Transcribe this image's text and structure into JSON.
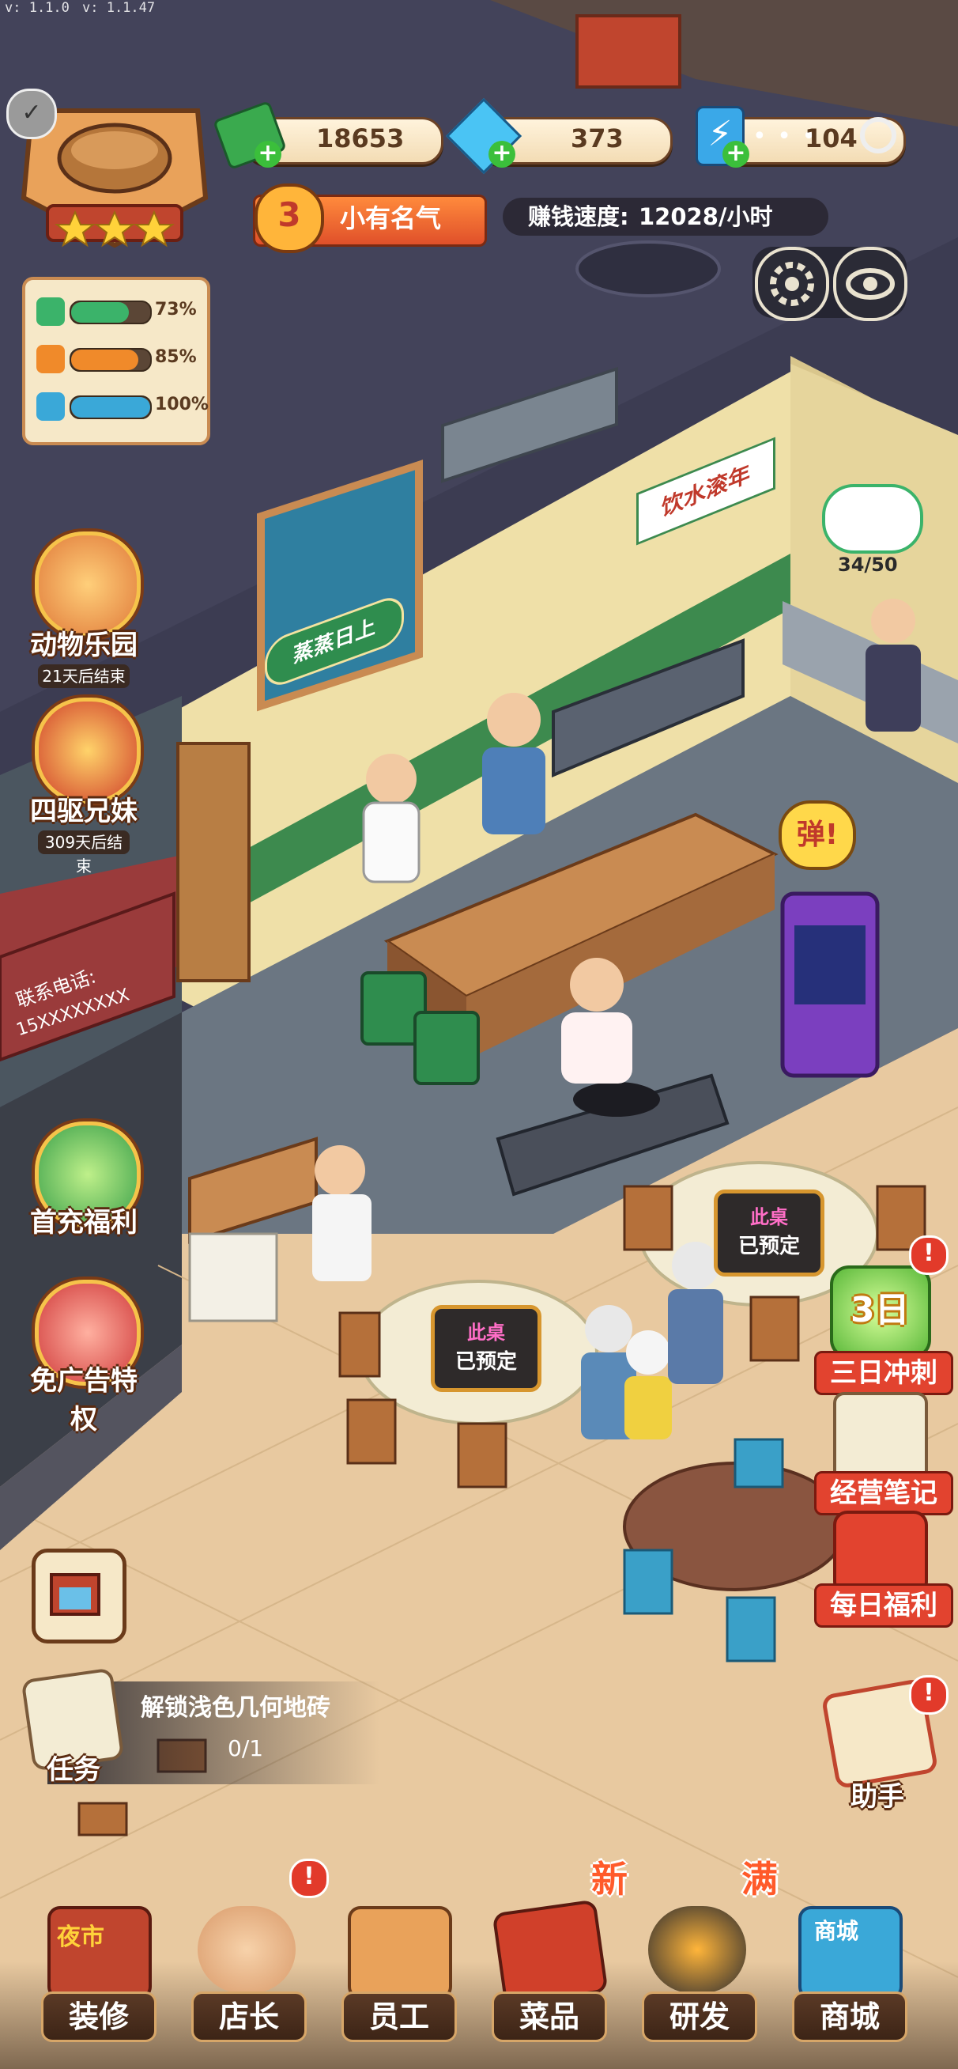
{
  "version": {
    "left": "v: 1.1.0",
    "right": "v: 1.1.47"
  },
  "resources": {
    "cash": "18653",
    "gems": "373",
    "energy": "104"
  },
  "fame": {
    "level": "3",
    "title": "小有名气"
  },
  "earn_rate": {
    "label": "赚钱速度:",
    "value": "12028/小时"
  },
  "stats": [
    {
      "name": "clover",
      "percent": "73%",
      "fraction": 0.73,
      "color": "#3bb36a"
    },
    {
      "name": "food",
      "percent": "85%",
      "fraction": 0.85,
      "color": "#f08a2a"
    },
    {
      "name": "staff",
      "percent": "100%",
      "fraction": 1.0,
      "color": "#3aa8d8"
    }
  ],
  "left_events": [
    {
      "label": "动物乐园",
      "timer": "21天后结束"
    },
    {
      "label": "四驱兄妹",
      "timer": "309天后结束"
    },
    {
      "label": "首充福利"
    },
    {
      "label": "免广告特权"
    }
  ],
  "right_events": [
    {
      "label": "三日冲刺",
      "badge": "3日"
    },
    {
      "label": "经营笔记"
    },
    {
      "label": "每日福利"
    }
  ],
  "assistant": {
    "label": "助手"
  },
  "task": {
    "label": "任务",
    "title": "解锁浅色几何地砖",
    "progress": "0/1"
  },
  "dish_counter": "34/50",
  "pop_bubble": "弹!",
  "shop_sign": "饮水滚年",
  "door_sign": "蒸蒸日上",
  "phone_sign": {
    "line1": "联系电话:",
    "line2": "15XXXXXXXX"
  },
  "tables": [
    {
      "line1": "此桌",
      "line2": "已预定"
    },
    {
      "line1": "此桌",
      "line2": "已预定"
    }
  ],
  "bottom_nav": [
    {
      "label": "装修",
      "pic": "夜市"
    },
    {
      "label": "店长"
    },
    {
      "label": "员工"
    },
    {
      "label": "菜品",
      "tag": "新"
    },
    {
      "label": "研发",
      "tag": "满"
    },
    {
      "label": "商城",
      "pic": "商城"
    }
  ],
  "colors": {
    "accent": "#f6c34a",
    "alert": "#e23a2a",
    "wall": "#efe0a8",
    "floor": "#e8c9a0"
  }
}
